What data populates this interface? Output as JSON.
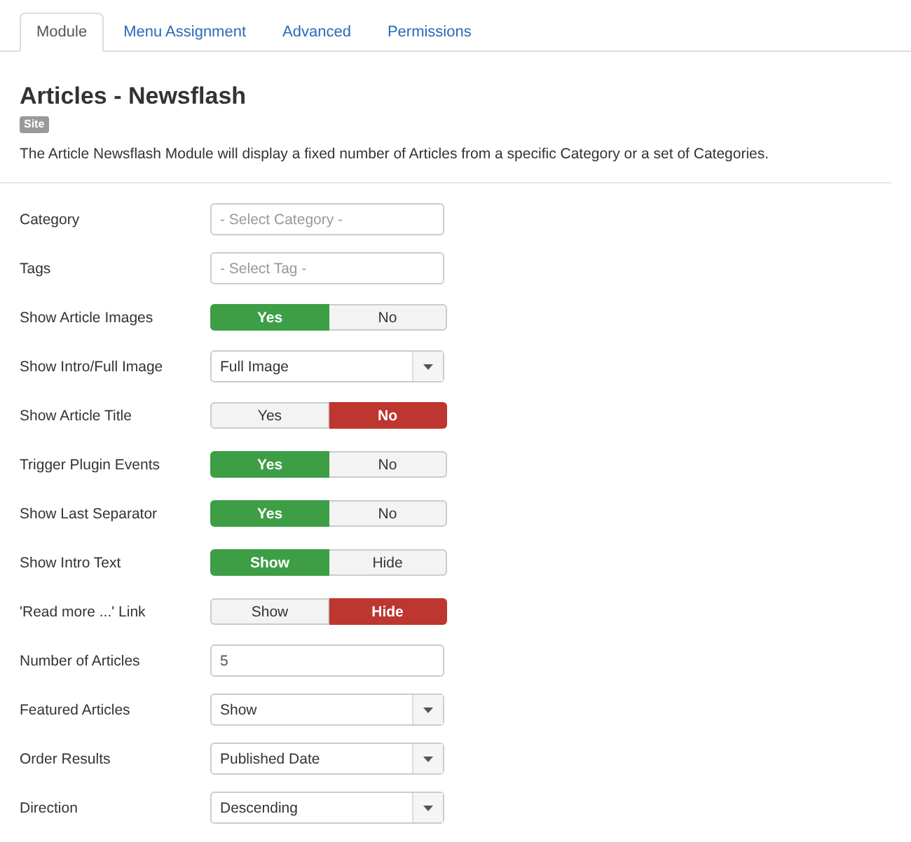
{
  "tabs": [
    {
      "label": "Module",
      "selected": true
    },
    {
      "label": "Menu Assignment",
      "selected": false
    },
    {
      "label": "Advanced",
      "selected": false
    },
    {
      "label": "Permissions",
      "selected": false
    }
  ],
  "title": "Articles - Newsflash",
  "badge": "Site",
  "description": "The Article Newsflash Module will display a fixed number of Articles from a specific Category or a set of Categories.",
  "fields": [
    {
      "label": "Category",
      "kind": "text",
      "placeholder": "- Select Category -"
    },
    {
      "label": "Tags",
      "kind": "text",
      "placeholder": "- Select Tag -"
    },
    {
      "label": "Show Article Images",
      "kind": "toggle",
      "options": [
        {
          "label": "Yes",
          "selected": true
        },
        {
          "label": "No",
          "selected": false
        }
      ]
    },
    {
      "label": "Show Intro/Full Image",
      "kind": "select",
      "value": "Full Image"
    },
    {
      "label": "Show Article Title",
      "kind": "toggle",
      "options": [
        {
          "label": "Yes",
          "selected": false
        },
        {
          "label": "No",
          "selected": true
        }
      ]
    },
    {
      "label": "Trigger Plugin Events",
      "kind": "toggle",
      "options": [
        {
          "label": "Yes",
          "selected": true
        },
        {
          "label": "No",
          "selected": false
        }
      ]
    },
    {
      "label": "Show Last Separator",
      "kind": "toggle",
      "options": [
        {
          "label": "Yes",
          "selected": true
        },
        {
          "label": "No",
          "selected": false
        }
      ]
    },
    {
      "label": "Show Intro Text",
      "kind": "toggle",
      "options": [
        {
          "label": "Show",
          "selected": true
        },
        {
          "label": "Hide",
          "selected": false
        }
      ]
    },
    {
      "label": "'Read more ...' Link",
      "kind": "toggle",
      "options": [
        {
          "label": "Show",
          "selected": false
        },
        {
          "label": "Hide",
          "selected": true
        }
      ]
    },
    {
      "label": "Number of Articles",
      "kind": "text",
      "value": "5"
    },
    {
      "label": "Featured Articles",
      "kind": "select",
      "value": "Show"
    },
    {
      "label": "Order Results",
      "kind": "select",
      "value": "Published Date"
    },
    {
      "label": "Direction",
      "kind": "select",
      "value": "Descending"
    }
  ]
}
